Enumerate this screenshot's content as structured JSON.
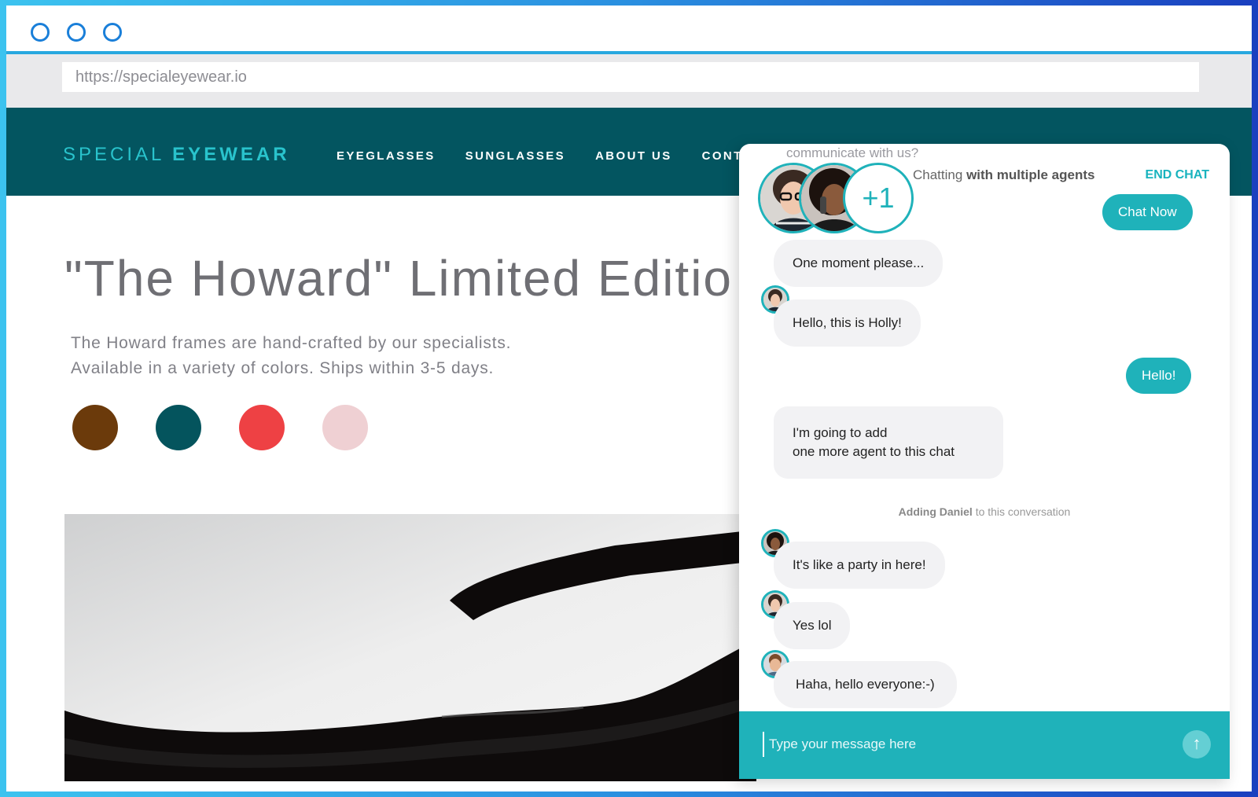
{
  "browser": {
    "url": "https://specialeyewear.io"
  },
  "site": {
    "logo_light": "SPECIAL",
    "logo_bold": "EYEWEAR",
    "nav": [
      "EYEGLASSES",
      "SUNGLASSES",
      "ABOUT US",
      "CONTACT"
    ]
  },
  "product": {
    "title": "\"The Howard\" Limited Editio",
    "desc_line1": "The Howard frames are hand-crafted by our specialists.",
    "desc_line2": "Available in a variety of colors. Ships within 3-5 days.",
    "swatch_colors": [
      "#6b3a0b",
      "#04545d",
      "#ee4144",
      "#efd0d3"
    ]
  },
  "chat": {
    "top_note": "communicate with us?",
    "status_prefix": "Chatting",
    "status_bold": "with multiple agents",
    "end_chat": "END CHAT",
    "extra_agents": "+1",
    "chat_now": "Chat Now",
    "messages": {
      "m1": "One moment please...",
      "m2": "Hello, this is Holly!",
      "m3": "Hello!",
      "m4_line1": "I'm going to add",
      "m4_line2": "one more agent to this chat",
      "m5": "It's like a party in here!",
      "m6": "Yes lol",
      "m7": "Haha, hello everyone:-)"
    },
    "system_note_bold": "Adding Daniel",
    "system_note_rest": "to this conversation",
    "input_placeholder": "Type your message here",
    "accent": "#1fb2ba"
  }
}
